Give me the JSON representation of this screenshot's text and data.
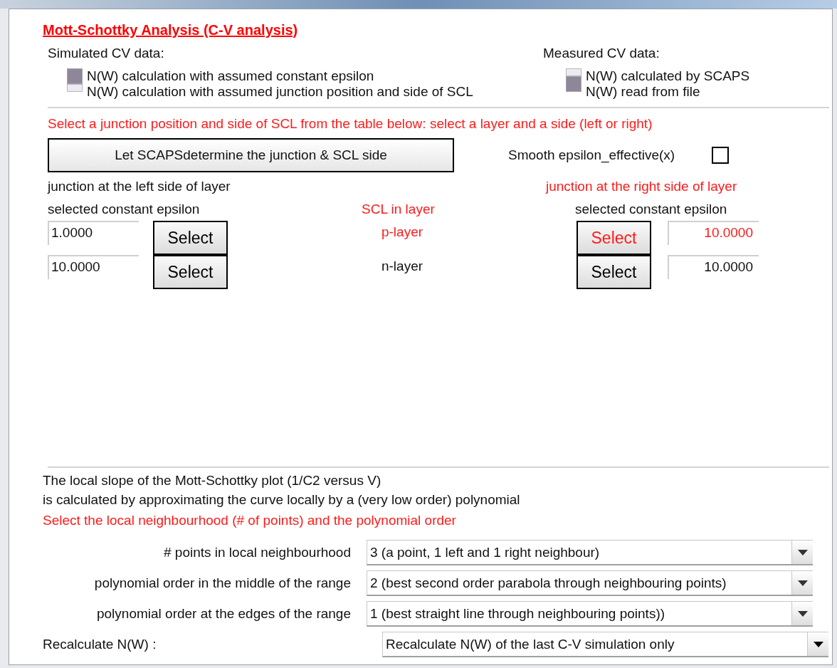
{
  "title": "Mott-Schottky Analysis (C-V analysis)",
  "simulated": {
    "label": "Simulated CV data:",
    "options": [
      {
        "label": "N(W) calculation with assumed constant epsilon",
        "selected": true
      },
      {
        "label": "N(W) calculation with assumed junction position and side of  SCL",
        "selected": false
      }
    ]
  },
  "measured": {
    "label": "Measured CV data:",
    "options": [
      {
        "label": "N(W) calculated by SCAPS",
        "selected": false
      },
      {
        "label": "N(W) read from file",
        "selected": true
      }
    ]
  },
  "instruction": "Select a junction position and side of SCL from the table below: select a layer and a side (left or right)",
  "auto_button": "Let SCAPSdetermine the junction & SCL side",
  "smooth": {
    "label": "Smooth epsilon_effective(x)",
    "checked": false
  },
  "left_heading": "junction at the left side of layer",
  "right_heading": "junction at the right side of layer",
  "left_sub": "selected constant epsilon",
  "middle_sub": "SCL in layer",
  "right_sub": "selected constant epsilon",
  "layers": [
    {
      "name": "p-layer",
      "left_value": "1.0000",
      "left_button": "Select",
      "left_selected": false,
      "right_button": "Select",
      "right_value": "10.0000",
      "right_selected": true
    },
    {
      "name": "n-layer",
      "left_value": "10.0000",
      "left_button": "Select",
      "left_selected": false,
      "right_button": "Select",
      "right_value": "10.0000",
      "right_selected": false
    }
  ],
  "slope_text": [
    "The local slope of the Mott-Schottky plot (1/C2 versus V)",
    "is calculated by approximating the curve locally by a (very low order) polynomial"
  ],
  "slope_instruction": "Select the local neighbourhood (# of points) and the polynomial order",
  "dropdowns": [
    {
      "label": "# points in local neighbourhood",
      "value": "3 (a point, 1 left and 1 right neighbour)",
      "kind": "indented"
    },
    {
      "label": "polynomial order in the middle of the range",
      "value": "2 (best second order parabola through neighbouring points)",
      "kind": "indented"
    },
    {
      "label": "polynomial order at the edges of the range",
      "value": "1 (best straight line through neighbouring points))",
      "kind": "indented"
    },
    {
      "label": "Recalculate N(W) :",
      "value": "Recalculate N(W) of the last C-V simulation only",
      "kind": "flush"
    }
  ]
}
